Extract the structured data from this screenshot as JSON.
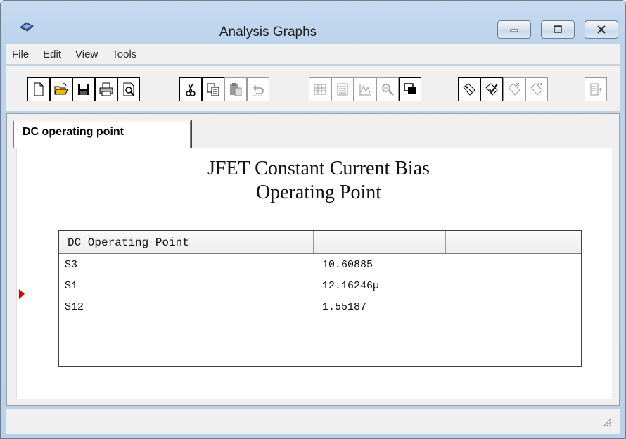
{
  "window": {
    "title": "Analysis Graphs"
  },
  "menu": [
    "File",
    "Edit",
    "View",
    "Tools"
  ],
  "toolbar": {
    "icons": [
      "new-icon",
      "open-icon",
      "save-icon",
      "print-icon",
      "print-preview-icon",
      "cut-icon",
      "copy-icon",
      "paste-icon",
      "undo-icon",
      "grid-icon",
      "list-icon",
      "chart-icon",
      "zoom-icon",
      "window-icon",
      "tag-icon",
      "check-tag-icon",
      "tag-add-icon",
      "tag-remove-icon",
      "export-icon"
    ]
  },
  "tab": {
    "label": "DC operating point"
  },
  "chart": {
    "title_line1": "JFET Constant Current Bias",
    "title_line2": "Operating Point"
  },
  "table": {
    "header": "DC Operating Point",
    "rows": [
      {
        "name": "$3",
        "value": "10.60885"
      },
      {
        "name": "$1",
        "value": "12.16246µ"
      },
      {
        "name": "$12",
        "value": "1.55187"
      }
    ]
  },
  "colors": {
    "marker": "#e00000",
    "chrome": "#bcd3ec"
  }
}
